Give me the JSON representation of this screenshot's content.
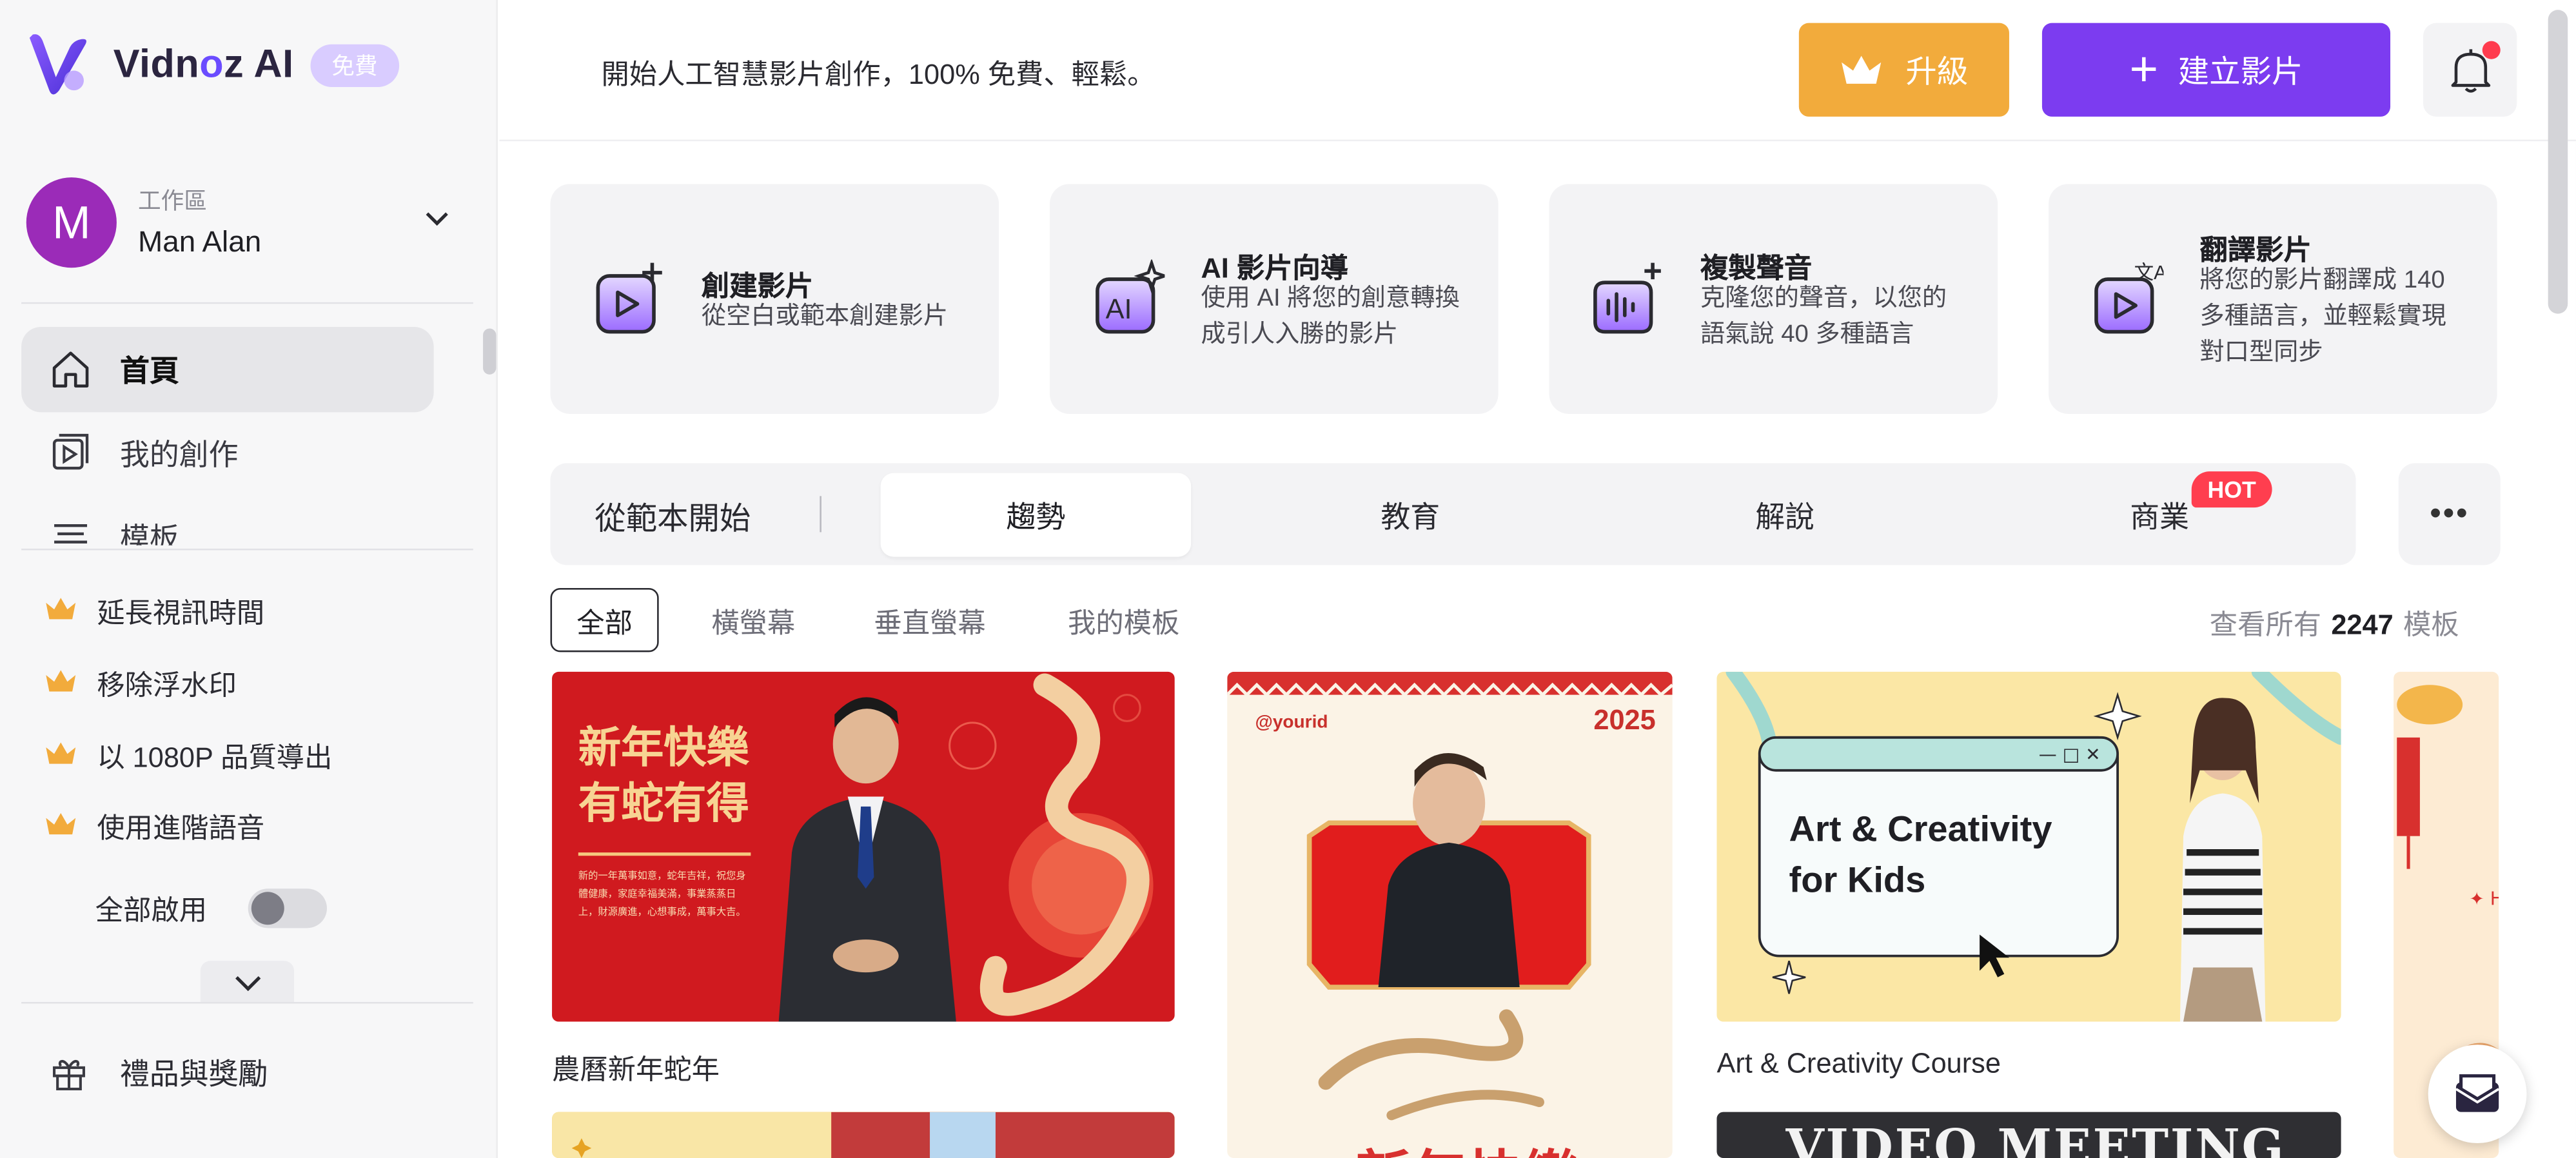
{
  "brand": {
    "name_a": "Vidn",
    "name_o": "o",
    "name_b": "z AI",
    "badge": "免費",
    "accent": "#7c3cf0"
  },
  "workspace": {
    "label": "工作區",
    "name": "Man Alan",
    "avatar_letter": "M"
  },
  "nav": [
    {
      "label": "首頁",
      "icon": "home-icon",
      "active": true
    },
    {
      "label": "我的創作",
      "icon": "play-square-icon",
      "active": false
    },
    {
      "label": "模板",
      "icon": "template-icon",
      "active": false
    }
  ],
  "perks": [
    "延長視訊時間",
    "移除浮水印",
    "以 1080P 品質導出",
    "使用進階語音"
  ],
  "enable_all": {
    "label": "全部啟用",
    "on": false
  },
  "gifts": {
    "label": "禮品與獎勵"
  },
  "topbar": {
    "tagline": "開始人工智慧影片創作，100% 免費、輕鬆。",
    "upgrade_label": "升級",
    "create_label": "建立影片"
  },
  "features": [
    {
      "title": "創建影片",
      "desc": "從空白或範本創建影片",
      "icon": "create-video-icon"
    },
    {
      "title": "AI 影片向導",
      "desc": "使用 AI 將您的創意轉換成引人入勝的影片",
      "icon": "ai-wizard-icon"
    },
    {
      "title": "複製聲音",
      "desc": "克隆您的聲音，以您的語氣說 40 多種語言",
      "icon": "clone-voice-icon"
    },
    {
      "title": "翻譯影片",
      "desc": "將您的影片翻譯成 140 多種語言，並輕鬆實現對口型同步",
      "icon": "translate-video-icon"
    }
  ],
  "tabs": {
    "lead": "從範本開始",
    "items": [
      "趨勢",
      "教育",
      "解說",
      "商業"
    ],
    "active": 0,
    "hot_badge": "HOT"
  },
  "filters": {
    "items": [
      "全部",
      "橫螢幕",
      "垂直螢幕",
      "我的模板"
    ],
    "active": 0
  },
  "view_all": {
    "prefix": "查看所有",
    "count": "2247",
    "suffix": "模板"
  },
  "templates": [
    {
      "caption": "農曆新年蛇年",
      "headline_1": "新年快樂",
      "headline_2": "有蛇有得",
      "body": "新的一年萬事如意，蛇年吉祥，祝您身體健康，家庭幸福美滿，事業蒸蒸日上，財源廣進，心想事成，萬事大吉。"
    },
    {
      "caption": "",
      "handle": "@yourid",
      "year": "2025",
      "footer_text": "新年快樂"
    },
    {
      "caption": "Art & Creativity Course",
      "card_line_1": "Art & Creativity",
      "card_line_2": "for Kids"
    },
    {
      "caption": ""
    }
  ],
  "bottom_row": {
    "meeting_title": "VIDEO MEETING"
  }
}
